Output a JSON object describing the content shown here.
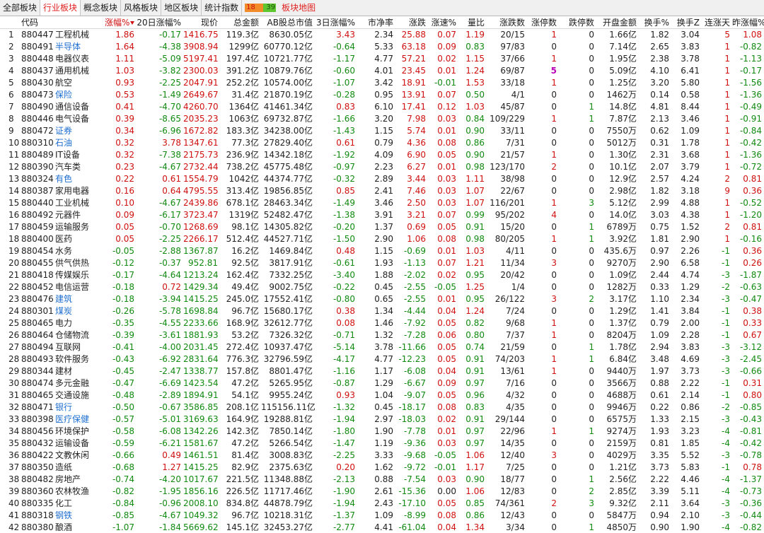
{
  "tabs": [
    {
      "label": "全部板块",
      "active": false
    },
    {
      "label": "行业板块",
      "active": true
    },
    {
      "label": "概念板块",
      "active": false
    },
    {
      "label": "风格板块",
      "active": false
    },
    {
      "label": "地区板块",
      "active": false
    },
    {
      "label": "统计指数",
      "active": false
    }
  ],
  "breadth": {
    "up": "18",
    "down": "39",
    "colors": {
      "up": "#f28c2a",
      "down": "#5ec62e"
    }
  },
  "map_tab": "板块地图",
  "colors": {
    "up": "#d01010",
    "down": "#118a11",
    "highlight_name": "#1f6fd0",
    "tab_active": "#e02020"
  },
  "columns": [
    "",
    "代码",
    "名称",
    "涨幅%",
    "20日涨幅%",
    "现价",
    "总金额",
    "AB股总市值",
    "3日涨幅%",
    "市净率",
    "涨跌",
    "涨速%",
    "量比",
    "涨跌数",
    "涨停数",
    "跌停数",
    "开盘金额",
    "换手%",
    "换手Z",
    "连涨天",
    "昨涨幅%"
  ],
  "column_headers": {
    "code": "代码",
    "chg": "涨幅%",
    "chg20": "20日涨幅%",
    "price": "现价",
    "amount": "总金额",
    "mktcap": "AB股总市值",
    "chg3": "3日涨幅%",
    "pb": "市净率",
    "change": "涨跌",
    "speed": "涨速%",
    "volratio": "量比",
    "updown": "涨跌数",
    "limitup": "涨停数",
    "limitdown": "跌停数",
    "openamt": "开盘金额",
    "turnover": "换手%",
    "turnoverz": "换手Z",
    "streak": "连涨天",
    "prevchg": "昨涨幅%"
  },
  "rows": [
    [
      "1",
      "880447",
      "工程机械",
      "1.86",
      "-0.17",
      "1416.75",
      "119.3亿",
      "8630.05亿",
      "3.43",
      "2.34",
      "25.88",
      "0.07",
      "1.19",
      "20/15",
      "1",
      "0",
      "1.66亿",
      "1.82",
      "3.04",
      "5",
      "1.08",
      false
    ],
    [
      "2",
      "880491",
      "半导体",
      "1.64",
      "-4.38",
      "3908.94",
      "1299亿",
      "60770.12亿",
      "-0.64",
      "5.33",
      "63.18",
      "0.09",
      "0.83",
      "97/83",
      "0",
      "0",
      "7.14亿",
      "2.65",
      "3.83",
      "1",
      "-0.82",
      true
    ],
    [
      "3",
      "880448",
      "电器仪表",
      "1.11",
      "-5.09",
      "5197.41",
      "197.4亿",
      "10721.77亿",
      "-1.17",
      "4.77",
      "57.21",
      "0.02",
      "1.15",
      "37/66",
      "1",
      "0",
      "1.95亿",
      "2.38",
      "3.78",
      "1",
      "-1.13",
      false
    ],
    [
      "4",
      "880437",
      "通用机械",
      "1.03",
      "-3.82",
      "2300.03",
      "391.2亿",
      "10879.76亿",
      "-0.60",
      "4.01",
      "23.45",
      "0.01",
      "1.24",
      "69/87",
      "5",
      "0",
      "5.09亿",
      "4.10",
      "6.41",
      "1",
      "-0.17",
      false
    ],
    [
      "5",
      "880430",
      "航空",
      "0.93",
      "-2.25",
      "2047.91",
      "252.2亿",
      "10574.00亿",
      "-1.07",
      "3.42",
      "18.91",
      "-0.01",
      "1.53",
      "33/18",
      "1",
      "0",
      "1.25亿",
      "3.20",
      "5.80",
      "1",
      "-1.56",
      false
    ],
    [
      "6",
      "880473",
      "保险",
      "0.53",
      "-1.49",
      "2649.67",
      "31.4亿",
      "21870.19亿",
      "-0.28",
      "0.95",
      "13.91",
      "0.07",
      "0.50",
      "4/1",
      "0",
      "0",
      "1462万",
      "0.14",
      "0.58",
      "1",
      "-1.36",
      true
    ],
    [
      "7",
      "880490",
      "通信设备",
      "0.41",
      "-4.70",
      "4260.70",
      "1364亿",
      "41461.34亿",
      "0.83",
      "6.10",
      "17.41",
      "0.12",
      "1.03",
      "45/87",
      "0",
      "1",
      "14.8亿",
      "4.81",
      "8.44",
      "1",
      "-0.49",
      false
    ],
    [
      "8",
      "880446",
      "电气设备",
      "0.39",
      "-8.65",
      "2035.23",
      "1063亿",
      "69732.87亿",
      "-1.66",
      "3.20",
      "7.98",
      "0.03",
      "0.84",
      "109/229",
      "1",
      "1",
      "7.87亿",
      "2.13",
      "3.46",
      "1",
      "-0.91",
      false
    ],
    [
      "9",
      "880472",
      "证券",
      "0.34",
      "-6.96",
      "1672.82",
      "183.3亿",
      "34238.00亿",
      "-1.43",
      "1.15",
      "5.74",
      "0.01",
      "0.90",
      "33/11",
      "0",
      "0",
      "7550万",
      "0.62",
      "1.09",
      "1",
      "-0.84",
      true
    ],
    [
      "10",
      "880310",
      "石油",
      "0.32",
      "3.78",
      "1347.61",
      "77.3亿",
      "27829.40亿",
      "0.61",
      "0.79",
      "4.36",
      "0.08",
      "0.86",
      "7/31",
      "0",
      "0",
      "5012万",
      "0.31",
      "1.78",
      "1",
      "-0.42",
      true
    ],
    [
      "11",
      "880489",
      "IT设备",
      "0.32",
      "-7.38",
      "2175.73",
      "236.9亿",
      "14342.18亿",
      "-1.92",
      "4.09",
      "6.90",
      "0.05",
      "0.90",
      "21/57",
      "1",
      "0",
      "1.30亿",
      "2.31",
      "3.68",
      "1",
      "-1.36",
      false
    ],
    [
      "12",
      "880390",
      "汽车类",
      "0.23",
      "-4.67",
      "2732.44",
      "738.2亿",
      "45775.48亿",
      "-0.97",
      "2.23",
      "6.27",
      "0.01",
      "0.98",
      "123/170",
      "2",
      "0",
      "10.1亿",
      "2.07",
      "3.79",
      "1",
      "-0.72",
      false
    ],
    [
      "13",
      "880324",
      "有色",
      "0.22",
      "0.61",
      "1554.79",
      "1042亿",
      "44374.77亿",
      "-0.32",
      "2.89",
      "3.44",
      "0.03",
      "1.11",
      "38/98",
      "0",
      "0",
      "12.9亿",
      "2.57",
      "4.24",
      "2",
      "0.81",
      true
    ],
    [
      "14",
      "880387",
      "家用电器",
      "0.16",
      "0.64",
      "4795.55",
      "313.4亿",
      "19856.85亿",
      "0.85",
      "2.41",
      "7.46",
      "0.03",
      "1.07",
      "22/67",
      "0",
      "0",
      "2.98亿",
      "1.82",
      "3.18",
      "9",
      "0.36",
      false
    ],
    [
      "15",
      "880440",
      "工业机械",
      "0.10",
      "-4.67",
      "2439.86",
      "678.1亿",
      "28463.34亿",
      "-1.49",
      "3.46",
      "2.50",
      "0.03",
      "1.07",
      "116/201",
      "1",
      "3",
      "5.12亿",
      "2.99",
      "4.88",
      "1",
      "-0.52",
      false
    ],
    [
      "16",
      "880492",
      "元器件",
      "0.09",
      "-6.17",
      "3723.47",
      "1319亿",
      "52482.47亿",
      "-1.38",
      "3.91",
      "3.21",
      "0.07",
      "0.99",
      "95/202",
      "4",
      "0",
      "14.0亿",
      "3.03",
      "4.38",
      "1",
      "-1.20",
      false
    ],
    [
      "17",
      "880459",
      "运输服务",
      "0.05",
      "-0.70",
      "1268.69",
      "98.1亿",
      "14305.82亿",
      "-0.20",
      "1.37",
      "0.69",
      "0.05",
      "0.91",
      "15/20",
      "0",
      "1",
      "6789万",
      "0.75",
      "1.52",
      "2",
      "0.81",
      false
    ],
    [
      "18",
      "880400",
      "医药",
      "0.05",
      "-2.25",
      "2266.17",
      "512.4亿",
      "44527.71亿",
      "-1.50",
      "2.90",
      "1.06",
      "0.08",
      "0.98",
      "80/205",
      "1",
      "1",
      "3.92亿",
      "1.81",
      "2.90",
      "1",
      "-0.16",
      false
    ],
    [
      "19",
      "880454",
      "水务",
      "-0.05",
      "-2.88",
      "1367.87",
      "16.2亿",
      "1469.84亿",
      "0.48",
      "1.15",
      "-0.69",
      "0.01",
      "1.03",
      "4/11",
      "0",
      "0",
      "435.6万",
      "0.97",
      "2.26",
      "-1",
      "0.36",
      false
    ],
    [
      "20",
      "880455",
      "供气供热",
      "-0.12",
      "-0.37",
      "952.81",
      "92.5亿",
      "3817.91亿",
      "-0.61",
      "1.93",
      "-1.13",
      "0.07",
      "1.21",
      "11/34",
      "3",
      "0",
      "9270万",
      "2.90",
      "6.58",
      "-1",
      "0.26",
      false
    ],
    [
      "21",
      "880418",
      "传媒娱乐",
      "-0.17",
      "-4.64",
      "1213.24",
      "162.4亿",
      "7332.25亿",
      "-3.40",
      "1.88",
      "-2.02",
      "0.02",
      "0.95",
      "20/42",
      "0",
      "0",
      "1.09亿",
      "2.44",
      "4.74",
      "-3",
      "-1.87",
      false
    ],
    [
      "22",
      "880452",
      "电信运营",
      "-0.18",
      "0.72",
      "1429.34",
      "49.4亿",
      "9002.75亿",
      "-0.22",
      "0.45",
      "-2.55",
      "-0.05",
      "1.25",
      "1/4",
      "0",
      "0",
      "1282万",
      "0.33",
      "1.29",
      "-2",
      "-0.63",
      false
    ],
    [
      "23",
      "880476",
      "建筑",
      "-0.18",
      "-3.94",
      "1415.25",
      "245.0亿",
      "17552.41亿",
      "-0.80",
      "0.65",
      "-2.55",
      "0.01",
      "0.95",
      "26/122",
      "3",
      "2",
      "3.17亿",
      "1.10",
      "2.34",
      "-3",
      "-0.47",
      true
    ],
    [
      "24",
      "880301",
      "煤炭",
      "-0.26",
      "-5.78",
      "1698.84",
      "96.7亿",
      "15680.17亿",
      "0.38",
      "1.34",
      "-4.44",
      "0.04",
      "1.24",
      "7/24",
      "0",
      "0",
      "1.29亿",
      "1.41",
      "3.84",
      "-1",
      "0.38",
      true
    ],
    [
      "25",
      "880465",
      "电力",
      "-0.35",
      "-4.55",
      "2233.66",
      "168.9亿",
      "32612.77亿",
      "0.08",
      "1.46",
      "-7.92",
      "0.05",
      "0.82",
      "9/68",
      "1",
      "0",
      "1.37亿",
      "0.79",
      "2.00",
      "-1",
      "0.33",
      false
    ],
    [
      "26",
      "880464",
      "仓储物流",
      "-0.39",
      "-3.61",
      "1881.93",
      "53.2亿",
      "7326.32亿",
      "-0.71",
      "1.32",
      "-7.28",
      "0.06",
      "0.80",
      "7/37",
      "1",
      "0",
      "8204万",
      "1.09",
      "2.28",
      "-1",
      "0.67",
      false
    ],
    [
      "27",
      "880494",
      "互联网",
      "-0.41",
      "-4.00",
      "2031.45",
      "272.4亿",
      "10937.47亿",
      "-5.14",
      "3.78",
      "-11.66",
      "0.05",
      "0.74",
      "21/59",
      "0",
      "1",
      "1.78亿",
      "2.94",
      "3.83",
      "-3",
      "-3.12",
      false
    ],
    [
      "28",
      "880493",
      "软件服务",
      "-0.43",
      "-6.92",
      "2831.64",
      "776.3亿",
      "32796.59亿",
      "-4.17",
      "4.77",
      "-12.23",
      "0.05",
      "0.91",
      "74/203",
      "1",
      "1",
      "6.84亿",
      "3.48",
      "4.69",
      "-3",
      "-2.45",
      false
    ],
    [
      "29",
      "880344",
      "建材",
      "-0.45",
      "-2.47",
      "1338.77",
      "157.8亿",
      "8801.47亿",
      "-1.16",
      "1.17",
      "-6.08",
      "0.04",
      "0.91",
      "13/61",
      "1",
      "0",
      "9440万",
      "1.97",
      "3.73",
      "-3",
      "-0.66",
      false
    ],
    [
      "30",
      "880474",
      "多元金融",
      "-0.47",
      "-6.69",
      "1423.54",
      "47.2亿",
      "5265.95亿",
      "-0.87",
      "1.29",
      "-6.67",
      "0.09",
      "0.97",
      "7/16",
      "0",
      "0",
      "3566万",
      "0.88",
      "2.22",
      "-1",
      "0.31",
      false
    ],
    [
      "31",
      "880465",
      "交通设施",
      "-0.48",
      "-2.89",
      "1894.91",
      "54.1亿",
      "9955.24亿",
      "0.93",
      "1.04",
      "-9.07",
      "0.05",
      "0.96",
      "4/32",
      "0",
      "0",
      "4688万",
      "0.61",
      "2.14",
      "-1",
      "0.80",
      false
    ],
    [
      "32",
      "880471",
      "银行",
      "-0.50",
      "-0.67",
      "3586.85",
      "208.1亿",
      "115156.11亿",
      "-1.32",
      "0.45",
      "-18.17",
      "0.08",
      "0.83",
      "4/35",
      "0",
      "0",
      "9946万",
      "0.22",
      "0.86",
      "-2",
      "-0.85",
      true
    ],
    [
      "33",
      "880398",
      "医疗保健",
      "-0.57",
      "-5.01",
      "3169.63",
      "164.9亿",
      "19288.81亿",
      "-1.94",
      "2.97",
      "-18.03",
      "0.02",
      "0.91",
      "29/144",
      "0",
      "0",
      "6575万",
      "1.33",
      "2.15",
      "-3",
      "-0.43",
      true
    ],
    [
      "34",
      "880456",
      "环境保护",
      "-0.58",
      "-6.08",
      "1342.26",
      "142.3亿",
      "7850.14亿",
      "-1.80",
      "1.90",
      "-7.78",
      "0.01",
      "0.97",
      "22/96",
      "1",
      "1",
      "9274万",
      "1.93",
      "3.23",
      "-4",
      "-0.81",
      false
    ],
    [
      "35",
      "880432",
      "运输设备",
      "-0.59",
      "-6.21",
      "1581.67",
      "47.2亿",
      "5266.54亿",
      "-1.47",
      "1.19",
      "-9.36",
      "0.03",
      "0.97",
      "14/35",
      "0",
      "0",
      "2159万",
      "0.81",
      "1.85",
      "-4",
      "-0.42",
      false
    ],
    [
      "36",
      "880422",
      "文教休闲",
      "-0.66",
      "0.49",
      "1461.51",
      "81.4亿",
      "3008.83亿",
      "-2.25",
      "3.33",
      "-9.68",
      "-0.05",
      "1.06",
      "12/40",
      "3",
      "0",
      "4029万",
      "3.35",
      "5.52",
      "-3",
      "-0.78",
      false
    ],
    [
      "37",
      "880350",
      "造纸",
      "-0.68",
      "1.27",
      "1415.25",
      "82.9亿",
      "2375.63亿",
      "0.20",
      "1.62",
      "-9.72",
      "-0.01",
      "1.17",
      "7/25",
      "0",
      "0",
      "1.21亿",
      "3.73",
      "5.83",
      "-1",
      "0.78",
      false
    ],
    [
      "38",
      "880482",
      "房地产",
      "-0.74",
      "-4.20",
      "1017.67",
      "221.5亿",
      "11348.88亿",
      "-2.13",
      "0.88",
      "-7.54",
      "0.03",
      "0.90",
      "18/77",
      "0",
      "1",
      "2.56亿",
      "2.22",
      "4.46",
      "-4",
      "-1.37",
      false
    ],
    [
      "39",
      "880360",
      "农林牧渔",
      "-0.82",
      "-1.95",
      "1856.16",
      "226.5亿",
      "11717.46亿",
      "-1.90",
      "2.61",
      "-15.36",
      "0.00",
      "1.06",
      "12/83",
      "0",
      "2",
      "2.85亿",
      "3.39",
      "5.11",
      "-4",
      "-0.73",
      false
    ],
    [
      "40",
      "880335",
      "化工",
      "-0.84",
      "-0.96",
      "2008.10",
      "834.8亿",
      "44878.79亿",
      "-1.94",
      "2.43",
      "-17.10",
      "0.05",
      "0.85",
      "74/361",
      "2",
      "3",
      "9.32亿",
      "2.11",
      "3.64",
      "-3",
      "-0.36",
      false
    ],
    [
      "41",
      "880318",
      "钢铁",
      "-0.85",
      "-4.67",
      "1049.32",
      "96.7亿",
      "10218.31亿",
      "-1.37",
      "1.09",
      "-8.99",
      "0.08",
      "0.86",
      "12/43",
      "0",
      "0",
      "5847万",
      "0.94",
      "2.10",
      "-3",
      "-0.44",
      true
    ],
    [
      "42",
      "880380",
      "酿酒",
      "-1.07",
      "-1.84",
      "5669.62",
      "145.1亿",
      "32453.27亿",
      "-2.77",
      "4.41",
      "-61.04",
      "0.04",
      "1.34",
      "3/34",
      "0",
      "1",
      "4850万",
      "0.90",
      "1.90",
      "-4",
      "-0.82",
      false
    ]
  ]
}
